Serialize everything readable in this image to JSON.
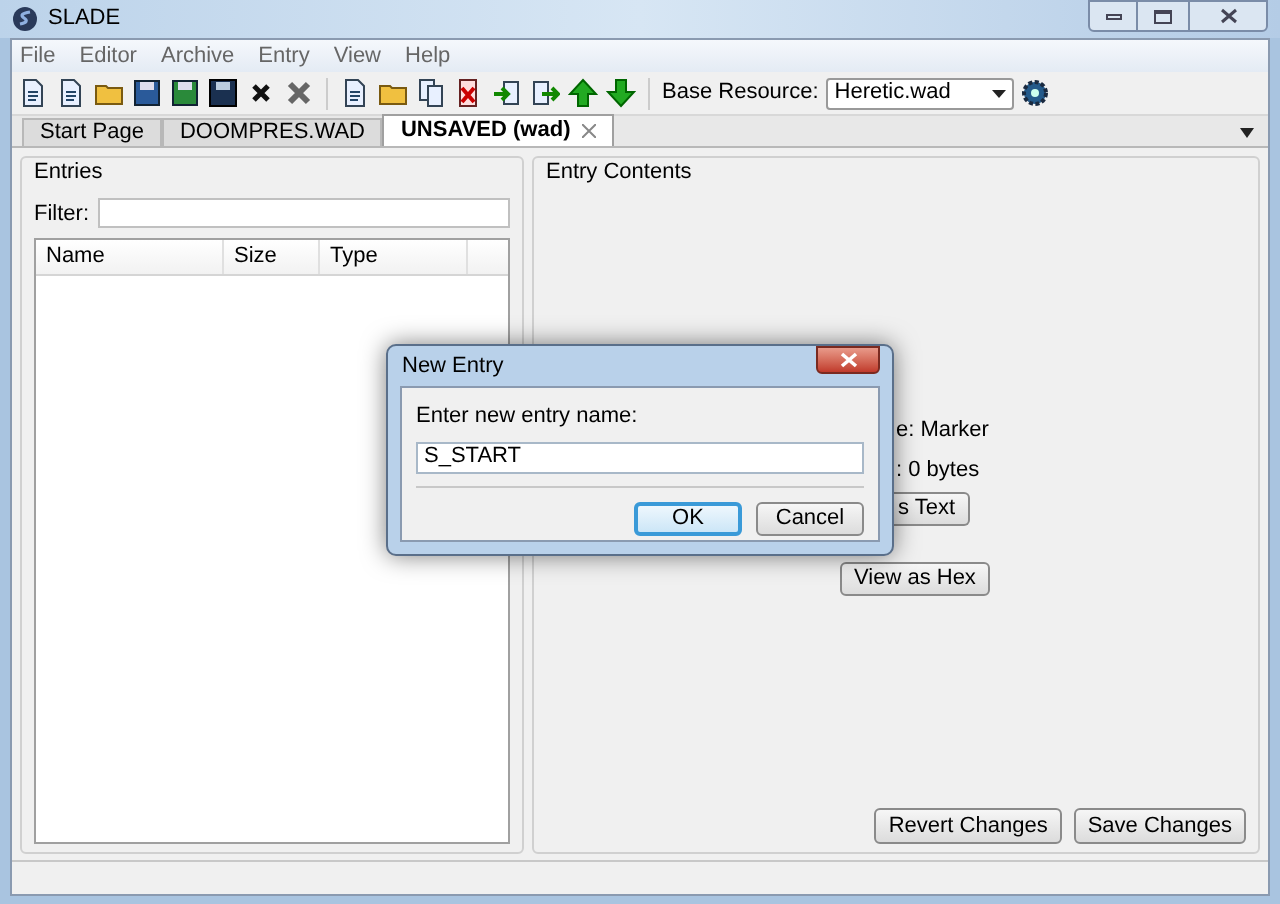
{
  "window": {
    "title": "SLADE"
  },
  "menu": [
    "File",
    "Editor",
    "Archive",
    "Entry",
    "View",
    "Help"
  ],
  "toolbar": {
    "groups": [
      [
        {
          "kind": "page"
        },
        {
          "kind": "page"
        },
        {
          "kind": "folder"
        },
        {
          "kind": "disk"
        },
        {
          "kind": "disk-green"
        },
        {
          "kind": "disk-dark"
        },
        {
          "kind": "cross"
        },
        {
          "kind": "cross-gray"
        }
      ],
      [
        {
          "kind": "page"
        },
        {
          "kind": "folder"
        },
        {
          "kind": "pages"
        },
        {
          "kind": "page-red"
        },
        {
          "kind": "import"
        },
        {
          "kind": "export"
        },
        {
          "kind": "arrow-up"
        },
        {
          "kind": "arrow-down"
        }
      ]
    ],
    "base_resource": {
      "label": "Base Resource:",
      "value": "Heretic.wad"
    }
  },
  "tabs": [
    {
      "label": "Start Page",
      "selected": false
    },
    {
      "label": "DOOMPRES.WAD",
      "selected": false
    },
    {
      "label": "UNSAVED (wad)",
      "selected": true
    }
  ],
  "entries_panel": {
    "title": "Entries",
    "filter_label": "Filter:",
    "columns": [
      "Name",
      "Size",
      "Type"
    ]
  },
  "contents_panel": {
    "title": "Entry Contents",
    "info": [
      "e: Marker",
      ": 0 bytes"
    ],
    "buttons": [
      "s Text",
      "View as Hex"
    ],
    "footer_buttons": [
      "Revert Changes",
      "Save Changes"
    ]
  },
  "dialog": {
    "title": "New Entry",
    "prompt": "Enter new entry name:",
    "value": "S_START",
    "buttons": [
      {
        "label": "OK",
        "default": true
      },
      {
        "label": "Cancel",
        "default": false
      }
    ]
  }
}
